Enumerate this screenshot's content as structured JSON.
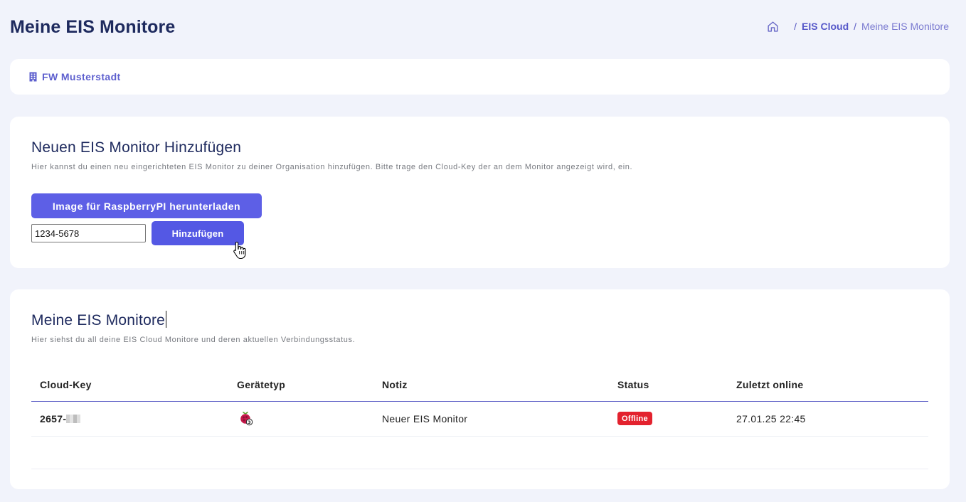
{
  "header": {
    "title": "Meine EIS Monitore",
    "breadcrumb": {
      "home_icon": "home-icon",
      "separator": "/",
      "link": "EIS Cloud",
      "current": "Meine EIS Monitore"
    }
  },
  "organization": {
    "icon": "building-icon",
    "name": "FW Musterstadt"
  },
  "add_section": {
    "title": "Neuen EIS Monitor Hinzufügen",
    "description": "Hier kannst du einen neu eingerichteten EIS Monitor zu deiner Organisation hinzufügen. Bitte trage den Cloud-Key der an dem Monitor angezeigt wird, ein.",
    "download_label": "Image für RaspberryPI herunterladen",
    "input_value": "1234-5678",
    "add_label": "Hinzufügen"
  },
  "list_section": {
    "title": "Meine EIS Monitore",
    "description": "Hier siehst du all deine EIS Cloud Monitore und deren aktuellen Verbindungsstatus.",
    "columns": [
      "Cloud-Key",
      "Gerätetyp",
      "Notiz",
      "Status",
      "Zuletzt online"
    ],
    "rows": [
      {
        "cloud_key": "2657-",
        "device_icon": "raspberry-pi-3-icon",
        "device_badge": "3",
        "note": "Neuer EIS Monitor",
        "status": "Offline",
        "last_online": "27.01.25 22:45"
      }
    ]
  },
  "colors": {
    "background": "#f1f3fb",
    "primary": "#5d5fe6",
    "title": "#1e2a5e",
    "status_offline": "#e3222e"
  }
}
